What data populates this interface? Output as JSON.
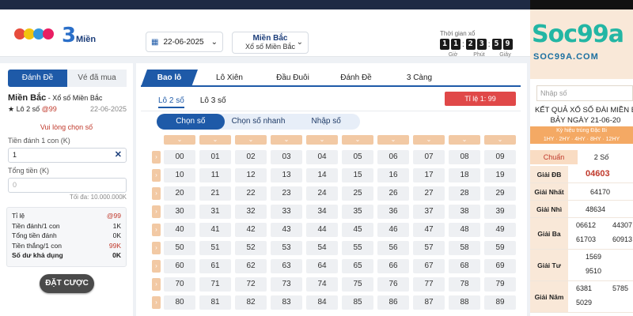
{
  "header": {
    "logo_text": "Miền",
    "logo_num": "3",
    "date": "22-06-2025",
    "region_title": "Miền Bắc",
    "region_sub": "Xổ số Miền Bắc",
    "timer_label": "Thời gian xổ",
    "timer_digits": [
      "1",
      "1",
      "2",
      "3",
      "5",
      "9"
    ],
    "timer_units": [
      "Giờ",
      "Phút",
      "Giây"
    ]
  },
  "left": {
    "tabs": [
      "Đánh Đề",
      "Vé đã mua"
    ],
    "title": "Miền Bắc",
    "title_sub": " - Xổ số Miền Bắc",
    "bet_type": "★ Lô 2 số",
    "bet_odds": "@99",
    "bet_date": "22-06-2025",
    "warning": "Vui lòng chọn số",
    "stake_label": "Tiền đánh 1 con (K)",
    "stake_value": "1",
    "total_label": "Tổng tiền (K)",
    "total_placeholder": "0",
    "max_note": "Tối đa: 10.000.000K",
    "summary": [
      {
        "label": "Tỉ lệ",
        "value": "@99",
        "red": true
      },
      {
        "label": "Tiền đánh/1 con",
        "value": "1K",
        "red": false
      },
      {
        "label": "Tổng tiền đánh",
        "value": "0K",
        "red": false
      },
      {
        "label": "Tiền thắng/1 con",
        "value": "99K",
        "red": true
      },
      {
        "label": "Số dư khả dụng",
        "value": "0K",
        "red": false,
        "bold": true
      }
    ],
    "bet_button": "ĐẶT CƯỢC"
  },
  "main": {
    "tabs": [
      "Bao lô",
      "Lô Xiên",
      "Đầu Đuôi",
      "Đánh Đề",
      "3 Càng"
    ],
    "subtabs": [
      "Lô 2 số",
      "Lô 3 số"
    ],
    "ratio": "Tỉ lệ 1: 99",
    "modes": [
      "Chọn số",
      "Chọn số nhanh",
      "Nhập số"
    ],
    "numbers": [
      [
        "00",
        "01",
        "02",
        "03",
        "04",
        "05",
        "06",
        "07",
        "08",
        "09"
      ],
      [
        "10",
        "11",
        "12",
        "13",
        "14",
        "15",
        "16",
        "17",
        "18",
        "19"
      ],
      [
        "20",
        "21",
        "22",
        "23",
        "24",
        "25",
        "26",
        "27",
        "28",
        "29"
      ],
      [
        "30",
        "31",
        "32",
        "33",
        "34",
        "35",
        "36",
        "37",
        "38",
        "39"
      ],
      [
        "40",
        "41",
        "42",
        "43",
        "44",
        "45",
        "46",
        "47",
        "48",
        "49"
      ],
      [
        "50",
        "51",
        "52",
        "53",
        "54",
        "55",
        "56",
        "57",
        "58",
        "59"
      ],
      [
        "60",
        "61",
        "62",
        "63",
        "64",
        "65",
        "66",
        "67",
        "68",
        "69"
      ],
      [
        "70",
        "71",
        "72",
        "73",
        "74",
        "75",
        "76",
        "77",
        "78",
        "79"
      ],
      [
        "80",
        "81",
        "82",
        "83",
        "84",
        "85",
        "86",
        "87",
        "88",
        "89"
      ]
    ]
  },
  "right": {
    "logo": "Soc99a",
    "site": "SOC99A.COM",
    "search_placeholder": "Nhập số",
    "title_line1": "KẾT QUẢ XỔ SỐ ĐÀI MIỀN B",
    "title_line2": "BẢY NGÀY 21-06-20",
    "bar_line1": "Kỳ hiệu trúng Đặc Bi",
    "bar_line2": "1HY · 2HY · 4HY · 8HY · 12HY",
    "tabs": [
      "Chuẩn",
      "2 Số"
    ],
    "results": [
      {
        "label": "Giải ĐB",
        "values": [
          "04603"
        ]
      },
      {
        "label": "Giải Nhất",
        "values": [
          "64170"
        ]
      },
      {
        "label": "Giải Nhì",
        "values": [
          "48634"
        ]
      },
      {
        "label": "Giải Ba",
        "values": [
          "06612",
          "44307",
          "61703",
          "60913"
        ]
      },
      {
        "label": "Giải Tư",
        "values": [
          "1569",
          "9510"
        ]
      },
      {
        "label": "Giải Năm",
        "values": [
          "6381",
          "5785",
          "5029"
        ]
      }
    ]
  },
  "colors": {
    "primary": "#1e5aa8",
    "accent_red": "#e04848",
    "peach": "#f2c9a4"
  }
}
